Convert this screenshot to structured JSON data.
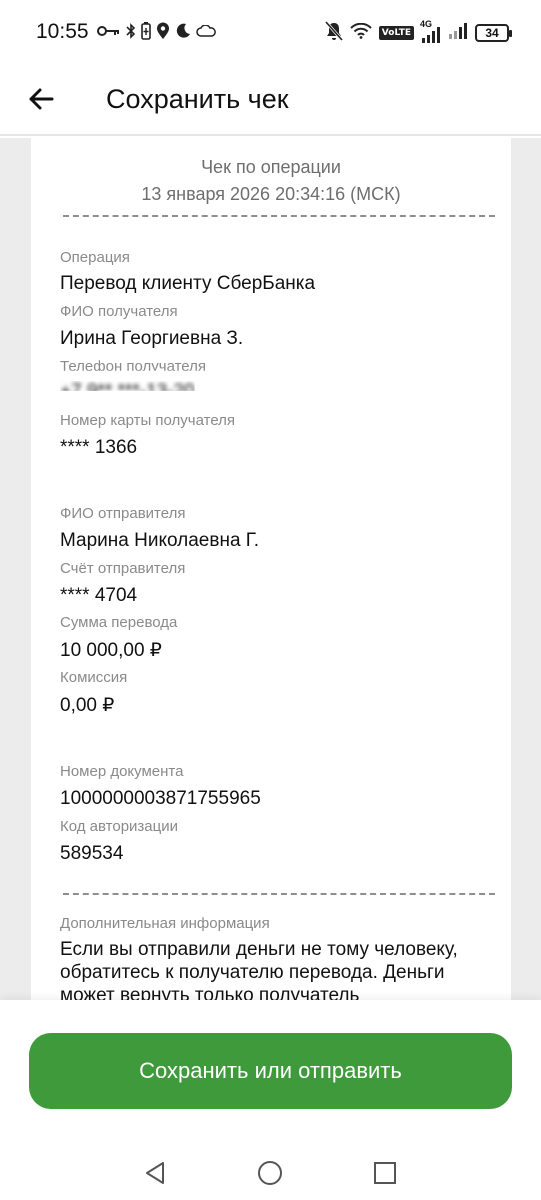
{
  "status_bar": {
    "time": "10:55",
    "left_icons": [
      "key-icon",
      "bluetooth-icon",
      "battery-saver-icon",
      "location-icon",
      "moon-icon",
      "cloud-icon"
    ],
    "right_icons": [
      "mute-icon",
      "wifi-icon",
      "volte-badge",
      "signal-icon",
      "signal-icon-2"
    ],
    "volte_label": "VoLTE",
    "network_label": "4G",
    "battery_level": "34"
  },
  "app_bar": {
    "title": "Сохранить чек",
    "back_icon": "arrow-left-icon"
  },
  "receipt": {
    "header_title": "Чек по операции",
    "header_datetime": "13 января 2026 20:34:16 (МСК)",
    "operation_label": "Операция",
    "operation_value": "Перевод клиенту СберБанка",
    "recipient_name_label": "ФИО получателя",
    "recipient_name_value": "Ирина Георгиевна З.",
    "recipient_phone_label": "Телефон получателя",
    "recipient_phone_value": "+7 9** ***-13-20",
    "recipient_card_label": "Номер карты получателя",
    "recipient_card_value": "**** 1366",
    "sender_name_label": "ФИО отправителя",
    "sender_name_value": "Марина Николаевна Г.",
    "sender_account_label": "Счёт отправителя",
    "sender_account_value": "**** 4704",
    "amount_label": "Сумма перевода",
    "amount_value": "10 000,00 ₽",
    "fee_label": "Комиссия",
    "fee_value": "0,00 ₽",
    "doc_number_label": "Номер документа",
    "doc_number_value": "1000000003871755965",
    "auth_code_label": "Код авторизации",
    "auth_code_value": "589534",
    "extra_info_label": "Дополнительная информация",
    "extra_info_text": "Если вы отправили деньги не тому человеку, обратитесь к получателю перевода. Деньги может вернуть только получатель"
  },
  "actions": {
    "save_or_send_label": "Сохранить или отправить"
  },
  "nav_bar": {
    "back_icon": "triangle-back-icon",
    "home_icon": "circle-home-icon",
    "recents_icon": "square-recents-icon"
  },
  "colors": {
    "primary_green": "#3f9a3c",
    "background_gray": "#ececec",
    "label_gray": "#8a8a8a"
  }
}
